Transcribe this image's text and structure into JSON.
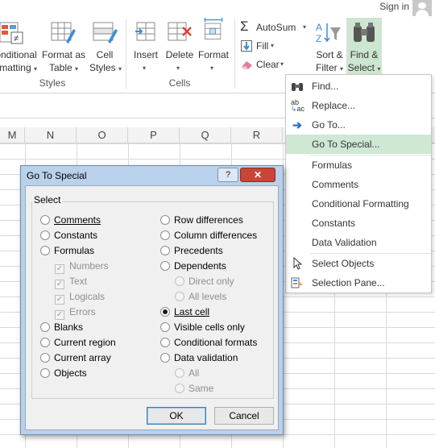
{
  "ribbon": {
    "signin": "Sign in",
    "styles": {
      "conditional_formatting": [
        "onditional",
        "matting"
      ],
      "format_as_table": [
        "Format as",
        "Table"
      ],
      "cell_styles": [
        "Cell",
        "Styles"
      ],
      "group_label": "Styles"
    },
    "cells": {
      "insert": "Insert",
      "delete": "Delete",
      "format": "Format",
      "group_label": "Cells"
    },
    "editing": {
      "autosum": "AutoSum",
      "fill": "Fill",
      "clear": "Clear",
      "sort_filter": [
        "Sort &",
        "Filter"
      ],
      "find_select": [
        "Find &",
        "Select"
      ]
    }
  },
  "columns": [
    "M",
    "N",
    "O",
    "P",
    "Q",
    "R"
  ],
  "menu": {
    "items": [
      {
        "label": "Find...",
        "icon": "binoculars-icon"
      },
      {
        "label": "Replace...",
        "icon": "replace-icon"
      },
      {
        "label": "Go To...",
        "icon": "arrow-right-icon"
      },
      {
        "label": "Go To Special...",
        "icon": ""
      },
      {
        "label": "Formulas",
        "icon": ""
      },
      {
        "label": "Comments",
        "icon": ""
      },
      {
        "label": "Conditional Formatting",
        "icon": ""
      },
      {
        "label": "Constants",
        "icon": ""
      },
      {
        "label": "Data Validation",
        "icon": ""
      },
      {
        "label": "Select Objects",
        "icon": "cursor-icon"
      },
      {
        "label": "Selection Pane...",
        "icon": "selection-pane-icon"
      }
    ],
    "highlighted_index": 3
  },
  "dialog": {
    "title": "Go To Special",
    "help_button": "?",
    "close_button": "✕",
    "group_label": "Select",
    "left_options": {
      "comments": "Comments",
      "constants": "Constants",
      "formulas": "Formulas",
      "numbers": "Numbers",
      "text": "Text",
      "logicals": "Logicals",
      "errors": "Errors",
      "blanks": "Blanks",
      "current_region": "Current region",
      "current_array": "Current array",
      "objects": "Objects"
    },
    "right_options": {
      "row_differences": "Row differences",
      "column_differences": "Column differences",
      "precedents": "Precedents",
      "dependents": "Dependents",
      "direct_only": "Direct only",
      "all_levels": "All levels",
      "last_cell": "Last cell",
      "visible_cells_only": "Visible cells only",
      "conditional_formats": "Conditional formats",
      "data_validation": "Data validation",
      "all": "All",
      "same": "Same"
    },
    "selected": "last_cell",
    "ok": "OK",
    "cancel": "Cancel"
  },
  "colors": {
    "highlight": "#cfe8d4",
    "find_select_active": "#cde6d0",
    "dialog_frame": "#b9d1ea",
    "close_red": "#c9453a"
  }
}
